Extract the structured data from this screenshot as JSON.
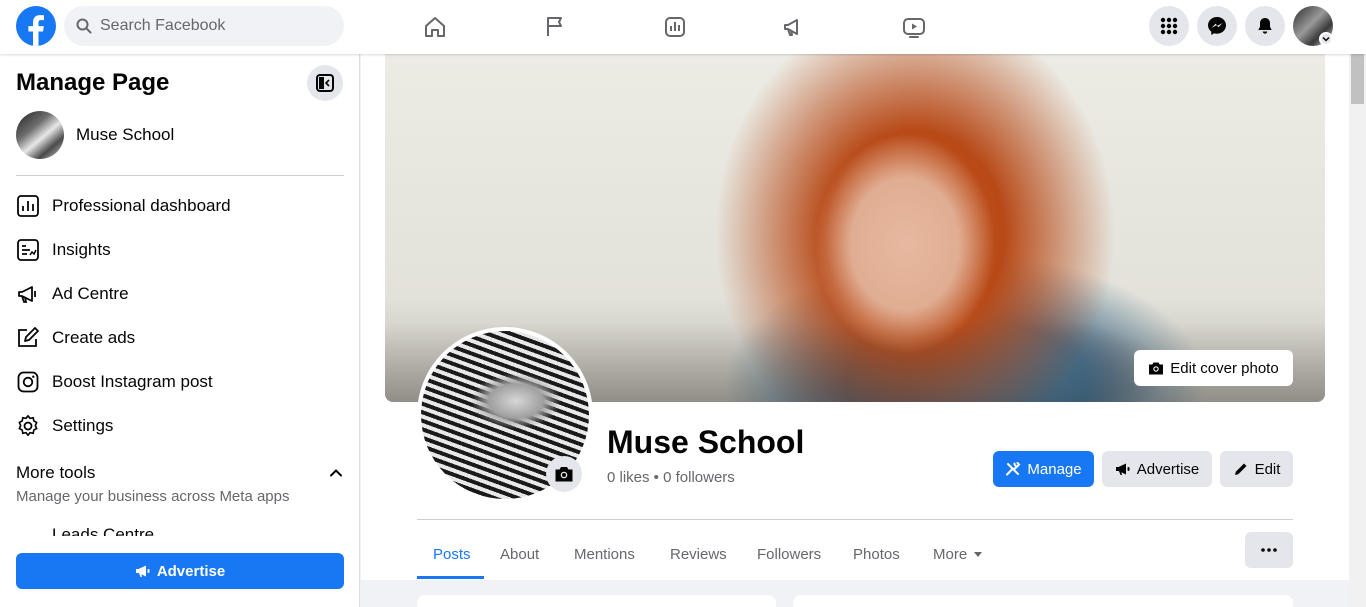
{
  "topbar": {
    "search_placeholder": "Search Facebook",
    "nav_icons": [
      "home-icon",
      "flag-icon",
      "insights-icon",
      "megaphone-icon",
      "video-icon"
    ],
    "right_icons": [
      "menu-grid-icon",
      "messenger-icon",
      "notifications-icon"
    ]
  },
  "sidebar": {
    "title": "Manage Page",
    "page_name": "Muse School",
    "items": [
      {
        "label": "Professional dashboard",
        "icon": "dashboard-icon"
      },
      {
        "label": "Insights",
        "icon": "insights-icon"
      },
      {
        "label": "Ad Centre",
        "icon": "megaphone-icon"
      },
      {
        "label": "Create ads",
        "icon": "edit-icon"
      },
      {
        "label": "Boost Instagram post",
        "icon": "instagram-icon"
      },
      {
        "label": "Settings",
        "icon": "gear-icon"
      }
    ],
    "more_tools": {
      "title": "More tools",
      "subtitle": "Manage your business across Meta apps",
      "first_item": "Leads Centre"
    },
    "advertise_label": "Advertise"
  },
  "main": {
    "edit_cover_label": "Edit cover photo",
    "page_name": "Muse School",
    "stats": "0 likes • 0 followers",
    "buttons": {
      "manage": "Manage",
      "advertise": "Advertise",
      "edit": "Edit"
    },
    "tabs": [
      {
        "label": "Posts",
        "active": true
      },
      {
        "label": "About",
        "active": false
      },
      {
        "label": "Mentions",
        "active": false
      },
      {
        "label": "Reviews",
        "active": false
      },
      {
        "label": "Followers",
        "active": false
      },
      {
        "label": "Photos",
        "active": false
      },
      {
        "label": "More",
        "active": false
      }
    ]
  },
  "colors": {
    "brand_blue": "#1877f2",
    "secondary_button": "#e4e6eb",
    "page_background": "#f0f2f5"
  }
}
